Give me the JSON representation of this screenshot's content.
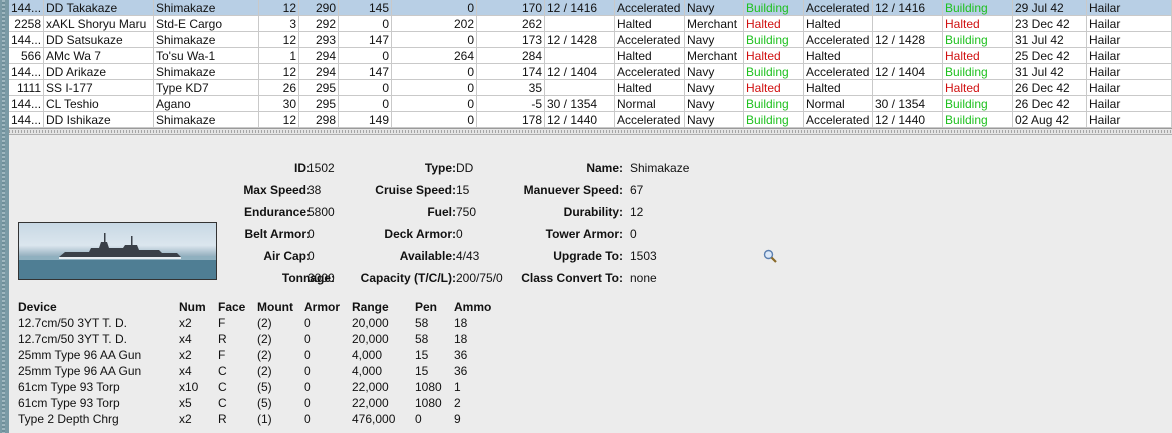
{
  "ships": [
    {
      "c0": "144...",
      "name": "DD Takakaze",
      "class": "Shimakaze",
      "n1": "12",
      "n2": "290",
      "n3": "145",
      "n4": "0",
      "n5": "170",
      "n6": "12 / 1416",
      "mode": "Accelerated",
      "type": "Navy",
      "s1": "Building",
      "s2": "Accelerated",
      "s3": "12 / 1416",
      "s4": "Building",
      "date": "29 Jul 42",
      "port": "Hailar",
      "c1": "",
      "c2": "green",
      "c3": "green"
    },
    {
      "c0": "2258",
      "name": "xAKL Shoryu Maru",
      "class": "Std-E Cargo",
      "n1": "3",
      "n2": "292",
      "n3": "0",
      "n4": "202",
      "n5": "262",
      "n6": "",
      "mode": "Halted",
      "type": "Merchant",
      "s1": "Halted",
      "s2": "Halted",
      "s3": "",
      "s4": "Halted",
      "date": "23 Dec 42",
      "port": "Hailar",
      "c1": "",
      "c2": "red",
      "c3": "red"
    },
    {
      "c0": "144...",
      "name": "DD Satsukaze",
      "class": "Shimakaze",
      "n1": "12",
      "n2": "293",
      "n3": "147",
      "n4": "0",
      "n5": "173",
      "n6": "12 / 1428",
      "mode": "Accelerated",
      "type": "Navy",
      "s1": "Building",
      "s2": "Accelerated",
      "s3": "12 / 1428",
      "s4": "Building",
      "date": "31 Jul 42",
      "port": "Hailar",
      "c1": "",
      "c2": "green",
      "c3": "green"
    },
    {
      "c0": "566",
      "name": "AMc Wa 7",
      "class": "To'su Wa-1",
      "n1": "1",
      "n2": "294",
      "n3": "0",
      "n4": "264",
      "n5": "284",
      "n6": "",
      "mode": "Halted",
      "type": "Merchant",
      "s1": "Halted",
      "s2": "Halted",
      "s3": "",
      "s4": "Halted",
      "date": "25 Dec 42",
      "port": "Hailar",
      "c1": "",
      "c2": "red",
      "c3": "red"
    },
    {
      "c0": "144...",
      "name": "DD Arikaze",
      "class": "Shimakaze",
      "n1": "12",
      "n2": "294",
      "n3": "147",
      "n4": "0",
      "n5": "174",
      "n6": "12 / 1404",
      "mode": "Accelerated",
      "type": "Navy",
      "s1": "Building",
      "s2": "Accelerated",
      "s3": "12 / 1404",
      "s4": "Building",
      "date": "31 Jul 42",
      "port": "Hailar",
      "c1": "",
      "c2": "green",
      "c3": "green"
    },
    {
      "c0": "1111",
      "name": "SS I-177",
      "class": "Type KD7",
      "n1": "26",
      "n2": "295",
      "n3": "0",
      "n4": "0",
      "n5": "35",
      "n6": "",
      "mode": "Halted",
      "type": "Navy",
      "s1": "Halted",
      "s2": "Halted",
      "s3": "",
      "s4": "Halted",
      "date": "26 Dec 42",
      "port": "Hailar",
      "c1": "",
      "c2": "red",
      "c3": "red"
    },
    {
      "c0": "144...",
      "name": "CL Teshio",
      "class": "Agano",
      "n1": "30",
      "n2": "295",
      "n3": "0",
      "n4": "0",
      "n5": "-5",
      "n6": "30 / 1354",
      "mode": "Normal",
      "type": "Navy",
      "s1": "Building",
      "s2": "Normal",
      "s3": "30 / 1354",
      "s4": "Building",
      "date": "26 Dec 42",
      "port": "Hailar",
      "c1": "",
      "c2": "green",
      "c3": "green"
    },
    {
      "c0": "144...",
      "name": "DD Ishikaze",
      "class": "Shimakaze",
      "n1": "12",
      "n2": "298",
      "n3": "149",
      "n4": "0",
      "n5": "178",
      "n6": "12 / 1440",
      "mode": "Accelerated",
      "type": "Navy",
      "s1": "Building",
      "s2": "Accelerated",
      "s3": "12 / 1440",
      "s4": "Building",
      "date": "02 Aug 42",
      "port": "Hailar",
      "c1": "",
      "c2": "green",
      "c3": "green"
    }
  ],
  "detail": {
    "id_label": "ID:",
    "id": "1502",
    "type_label": "Type:",
    "type": "DD",
    "name_label": "Name:",
    "name": "Shimakaze",
    "maxspeed_label": "Max Speed:",
    "maxspeed": "38",
    "cruise_label": "Cruise Speed:",
    "cruise": "15",
    "manuever_label": "Manuever Speed:",
    "manuever": "67",
    "endurance_label": "Endurance:",
    "endurance": "5800",
    "fuel_label": "Fuel:",
    "fuel": "750",
    "durability_label": "Durability:",
    "durability": "12",
    "belt_label": "Belt Armor:",
    "belt": "0",
    "deck_label": "Deck Armor:",
    "deck": "0",
    "tower_label": "Tower Armor:",
    "tower": "0",
    "aircap_label": "Air Cap:",
    "aircap": "0",
    "available_label": "Available:",
    "available": "4/43",
    "upgrade_label": "Upgrade To:",
    "upgrade": "1503",
    "tonnage_label": "Tonnage:",
    "tonnage": "3000",
    "capacity_label": "Capacity (T/C/L):",
    "capacity": "200/75/0",
    "convert_label": "Class Convert To:",
    "convert": "none"
  },
  "devices": {
    "headers": {
      "device": "Device",
      "num": "Num",
      "face": "Face",
      "mount": "Mount",
      "armor": "Armor",
      "range": "Range",
      "pen": "Pen",
      "ammo": "Ammo"
    },
    "rows": [
      {
        "device": "12.7cm/50 3YT T. D.",
        "num": "x2",
        "face": "F",
        "mount": "(2)",
        "armor": "0",
        "range": "20,000",
        "pen": "58",
        "ammo": "18"
      },
      {
        "device": "12.7cm/50 3YT T. D.",
        "num": "x4",
        "face": "R",
        "mount": "(2)",
        "armor": "0",
        "range": "20,000",
        "pen": "58",
        "ammo": "18"
      },
      {
        "device": "25mm Type 96 AA Gun",
        "num": "x2",
        "face": "F",
        "mount": "(2)",
        "armor": "0",
        "range": "4,000",
        "pen": "15",
        "ammo": "36"
      },
      {
        "device": "25mm Type 96 AA Gun",
        "num": "x4",
        "face": "C",
        "mount": "(2)",
        "armor": "0",
        "range": "4,000",
        "pen": "15",
        "ammo": "36"
      },
      {
        "device": "61cm Type 93 Torp",
        "num": "x10",
        "face": "C",
        "mount": "(5)",
        "armor": "0",
        "range": "22,000",
        "pen": "1080",
        "ammo": "1"
      },
      {
        "device": "61cm Type 93 Torp",
        "num": "x5",
        "face": "C",
        "mount": "(5)",
        "armor": "0",
        "range": "22,000",
        "pen": "1080",
        "ammo": "2"
      },
      {
        "device": "Type 2 Depth Chrg",
        "num": "x2",
        "face": "R",
        "mount": "(1)",
        "armor": "0",
        "range": "476,000",
        "pen": "0",
        "ammo": "9"
      }
    ]
  },
  "icons": {
    "search": "magnifier-icon",
    "ship": "ship-image"
  },
  "colors": {
    "building": "#1ec01e",
    "halted": "#d01010",
    "selected_row": "#b8cfe5"
  }
}
